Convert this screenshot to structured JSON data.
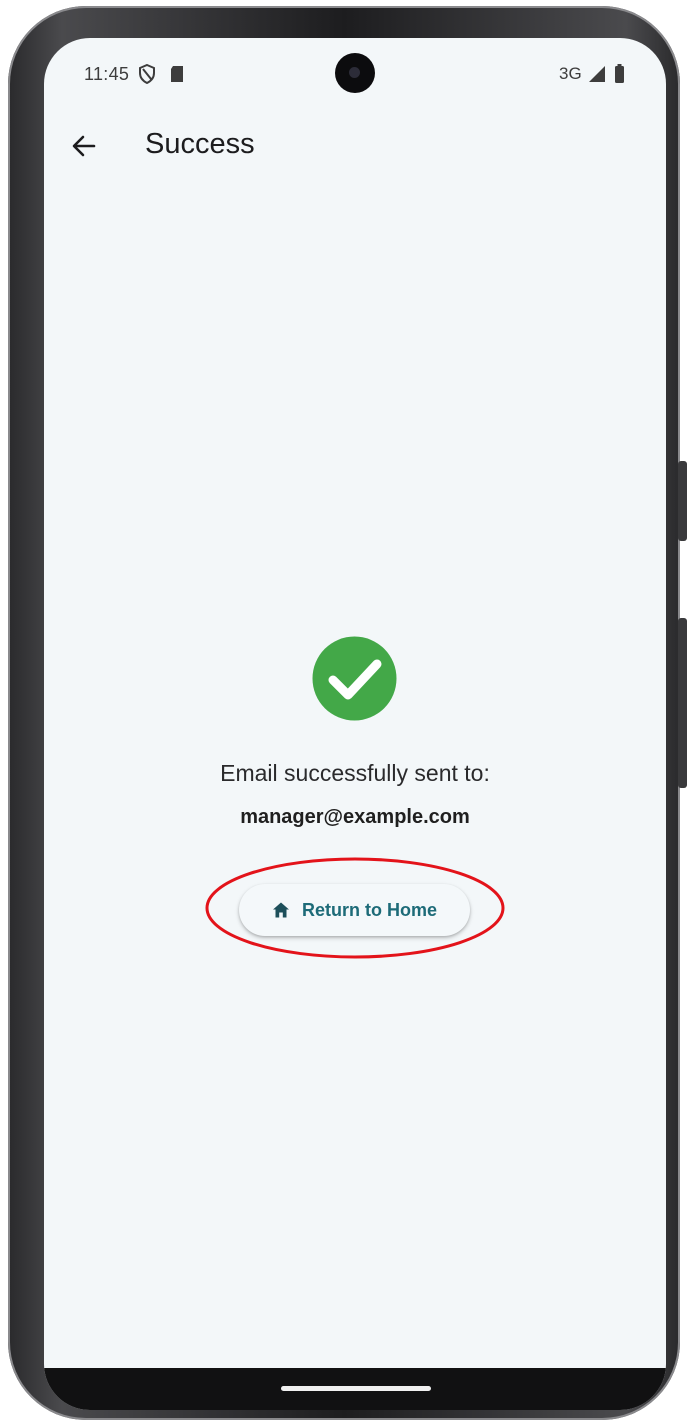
{
  "status_bar": {
    "time": "11:45",
    "network_type": "3G",
    "icons": [
      "shield-icon",
      "sd-card-icon",
      "signal-icon",
      "battery-icon"
    ]
  },
  "app_bar": {
    "title": "Success",
    "back_icon": "arrow-back-icon"
  },
  "content": {
    "status_icon": "check-circle-icon",
    "message": "Email successfully sent to:",
    "recipient_email": "manager@example.com"
  },
  "actions": {
    "return_home": {
      "label": "Return to Home",
      "icon": "home-icon"
    }
  },
  "colors": {
    "success_green": "#43a848",
    "primary_teal": "#1d6b78",
    "background": "#f3f7f9",
    "annotation_red": "#e3131a"
  }
}
